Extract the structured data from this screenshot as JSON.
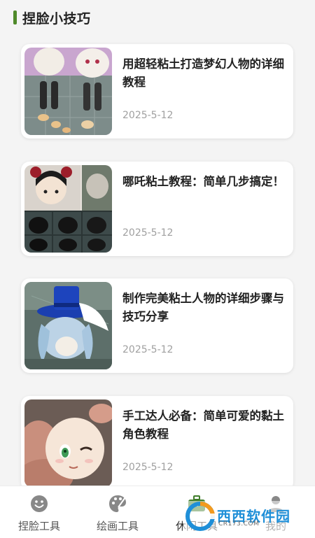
{
  "header": {
    "title": "捏脸小技巧",
    "accent_color": "#4f8a2a"
  },
  "articles": [
    {
      "title": "用超轻粘土打造梦幻人物的详细教程",
      "date": "2025-5-12",
      "image": "clay-doll-body-photo"
    },
    {
      "title": "哪吒粘土教程：简单几步搞定！",
      "date": "2025-5-12",
      "image": "nezha-clay-steps-photo"
    },
    {
      "title": "制作完美粘土人物的详细步骤与技巧分享",
      "date": "2025-5-12",
      "image": "clay-figure-blue-hat-photo"
    },
    {
      "title": "手工达人必备：简单可爱的黏土角色教程",
      "date": "2025-5-12",
      "image": "clay-face-in-hand-photo"
    }
  ],
  "tabbar": {
    "tabs": [
      {
        "label": "捏脸工具",
        "icon": "smile-face-icon"
      },
      {
        "label": "绘画工具",
        "icon": "palette-icon"
      },
      {
        "label": "休闲工具",
        "icon": "toolbox-icon"
      },
      {
        "label": "我的",
        "icon": "user-icon"
      }
    ],
    "active_index": 2
  },
  "watermark": {
    "text": "西西软件园",
    "sub": "CR173.COM"
  }
}
